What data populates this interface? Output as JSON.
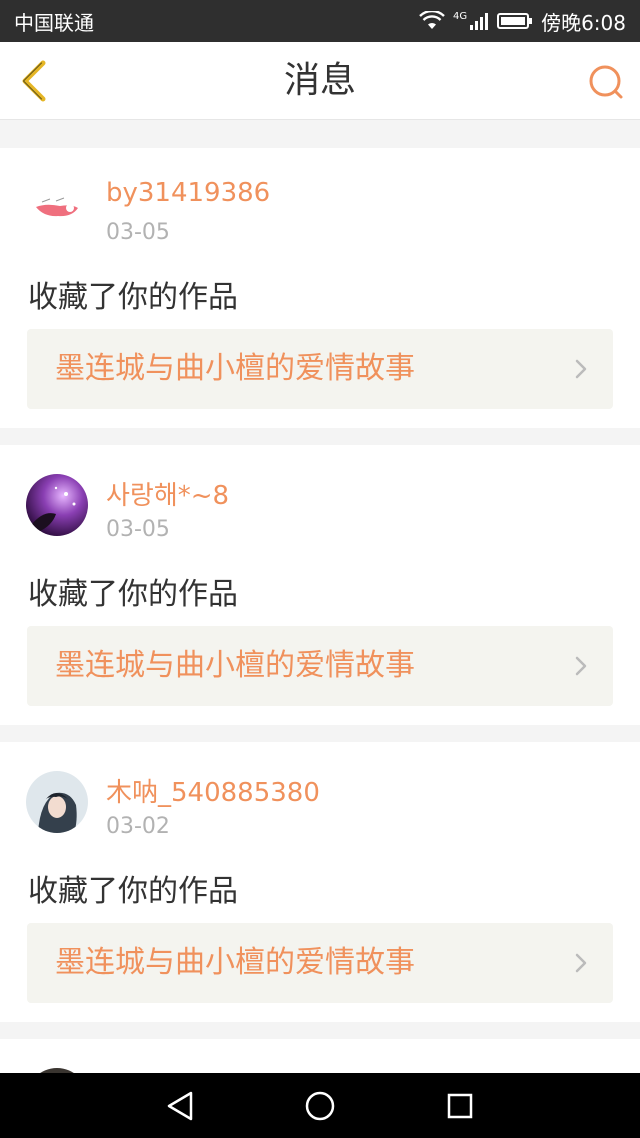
{
  "status_bar": {
    "carrier": "中国联通",
    "network": "4G",
    "time": "傍晚6:08"
  },
  "header": {
    "title": "消息"
  },
  "messages": [
    {
      "username": "by31419386",
      "date": "03-05",
      "action": "收藏了你的作品",
      "work_title": "墨连城与曲小檀的爱情故事"
    },
    {
      "username": "사랑해*~8",
      "date": "03-05",
      "action": "收藏了你的作品",
      "work_title": "墨连城与曲小檀的爱情故事"
    },
    {
      "username": "木呐_540885380",
      "date": "03-02",
      "action": "收藏了你的作品",
      "work_title": "墨连城与曲小檀的爱情故事"
    }
  ],
  "colors": {
    "accent": "#f0915c",
    "back_icon": "#e5b626",
    "link_bg": "#f4f4ef"
  },
  "icons": {
    "back": "chevron-left-icon",
    "search": "search-icon",
    "link": "chevron-right-icon"
  }
}
